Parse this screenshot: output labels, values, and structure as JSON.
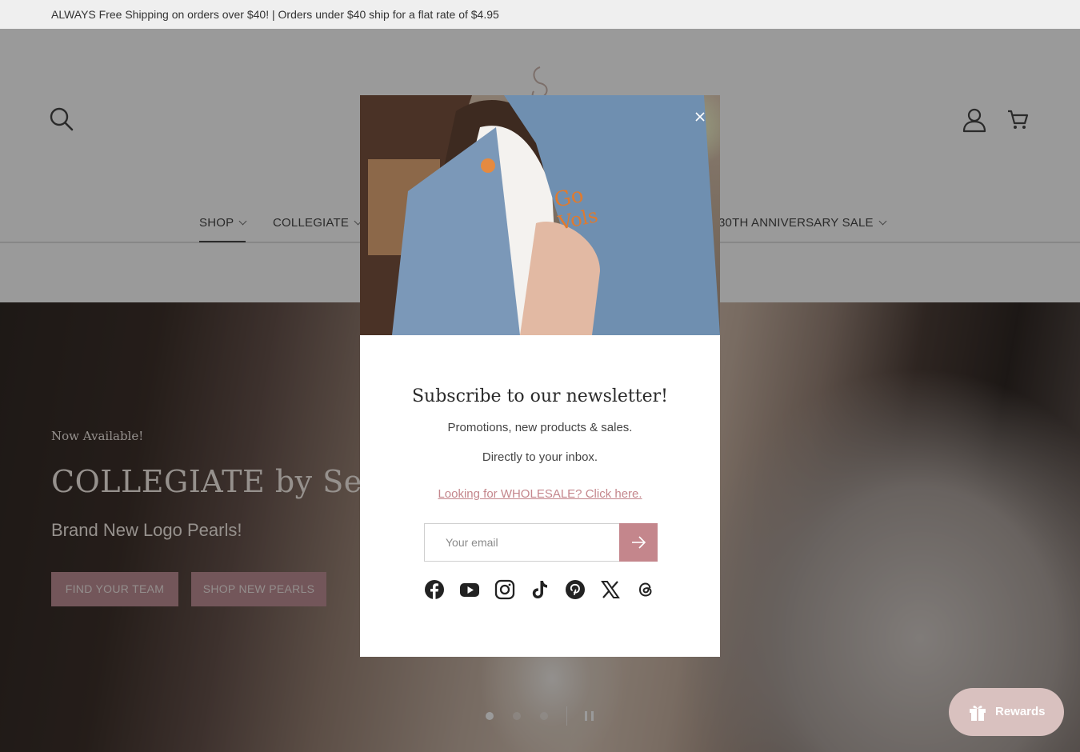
{
  "announcement": "ALWAYS Free Shipping on orders over $40! | Orders under $40 ship for a flat rate of $4.95",
  "header": {
    "icons": [
      "search-icon",
      "account-icon",
      "cart-icon"
    ]
  },
  "nav": {
    "items": [
      {
        "label": "SHOP",
        "active": true
      },
      {
        "label": "COLLEGIATE",
        "active": false
      },
      {
        "label": "30TH ANNIVERSARY SALE",
        "active": false
      }
    ]
  },
  "hero": {
    "eyebrow": "Now Available!",
    "headline": "COLLEGIATE by Seaso",
    "subheadline": "Brand New Logo Pearls!",
    "buttons": [
      "FIND YOUR TEAM",
      "SHOP NEW PEARLS"
    ],
    "slides": 3,
    "current_slide": 1
  },
  "modal": {
    "title": "Subscribe to our newsletter!",
    "line1": "Promotions, new products & sales.",
    "line2": "Directly to your inbox.",
    "wholesale_link": "Looking for WHOLESALE? Click here.",
    "email_placeholder": "Your email",
    "socials": [
      "facebook-icon",
      "youtube-icon",
      "instagram-icon",
      "tiktok-icon",
      "pinterest-icon",
      "x-icon",
      "threads-icon"
    ]
  },
  "rewards": {
    "label": "Rewards"
  },
  "colors": {
    "accent": "#c4868c",
    "announcement_bg": "#efefef",
    "rewards_bg": "#d9c1bf"
  }
}
